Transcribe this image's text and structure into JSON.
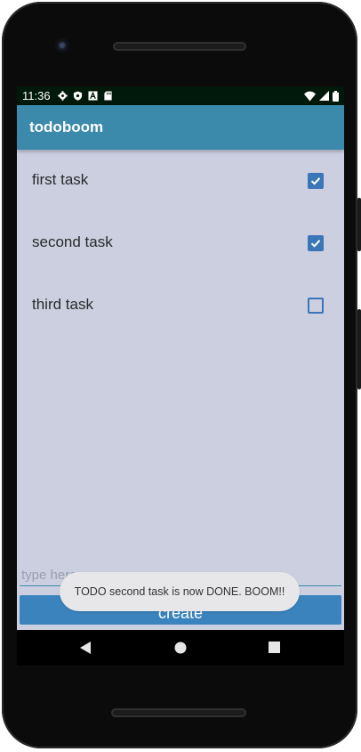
{
  "status_bar": {
    "time": "11:36",
    "left_icons": [
      "settings-icon",
      "shield-icon",
      "a-icon",
      "sd-card-icon"
    ],
    "right_icons": [
      "wifi-icon",
      "signal-icon",
      "battery-icon"
    ]
  },
  "app_bar": {
    "title": "todoboom",
    "color": "#3b89ab"
  },
  "tasks": [
    {
      "label": "first task",
      "done": true
    },
    {
      "label": "second task",
      "done": true
    },
    {
      "label": "third task",
      "done": false
    }
  ],
  "input": {
    "placeholder": "type here",
    "value": ""
  },
  "create_button": {
    "label": "create"
  },
  "toast": {
    "message": "TODO second task is now DONE. BOOM!!"
  },
  "nav_bar": {
    "buttons": [
      "back-icon",
      "home-icon",
      "recents-icon"
    ]
  },
  "colors": {
    "background": "#cbcfe0",
    "accent": "#3a83bd"
  }
}
